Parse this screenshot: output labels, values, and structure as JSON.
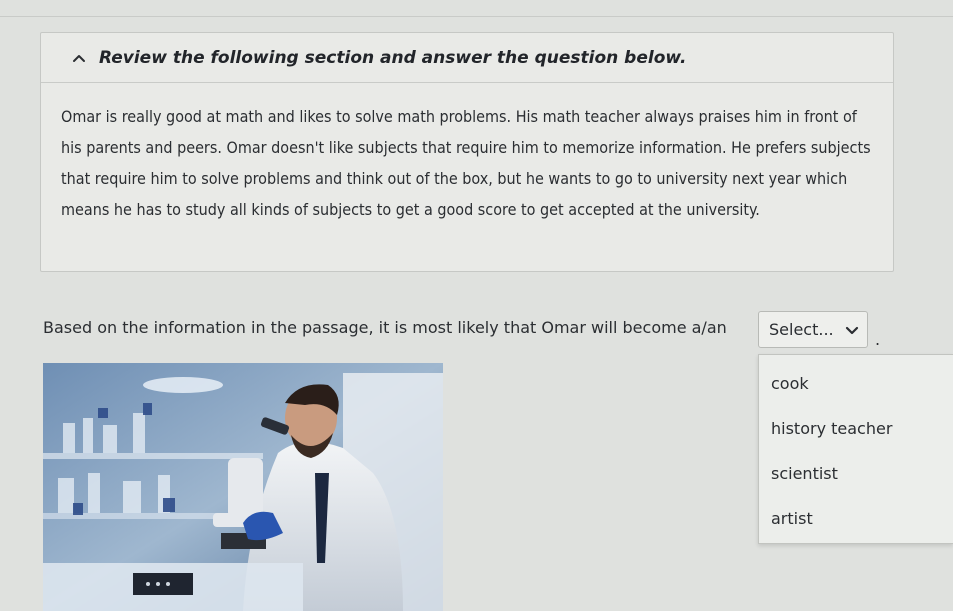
{
  "panel": {
    "header": "Review the following section and answer the question below.",
    "passage": "Omar is really good at math and likes to solve math problems. His math teacher always praises him in front of his parents and peers. Omar doesn't like subjects that require him to memorize information. He prefers subjects that require him to solve problems and think out of the box, but he wants to go to university next year which means he has to study all kinds of subjects to get a good score to get accepted at the university."
  },
  "question": {
    "text": "Based on the information in the passage, it is most likely that Omar will become a/an",
    "trailing": "."
  },
  "select": {
    "value": "Select...",
    "options": [
      "cook",
      "history teacher",
      "scientist",
      "artist"
    ]
  },
  "icons": {
    "collapse": "chevron-up-icon",
    "dropdown": "chevron-down-icon"
  },
  "colors": {
    "background": "#dfe1de",
    "panel": "#e9eae7",
    "text": "#2b2e32"
  }
}
